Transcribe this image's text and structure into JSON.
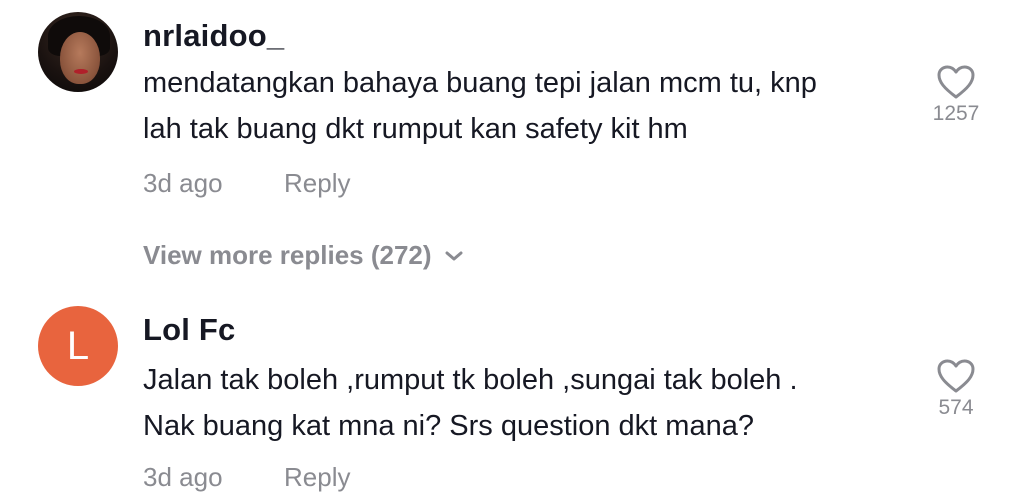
{
  "comments": [
    {
      "username": "nrlaidoo_",
      "avatar": "photo",
      "text_lines": [
        "mendatangkan bahaya buang tepi jalan mcm tu, knp",
        "lah tak buang dkt rumput kan safety kit hm"
      ],
      "time": "3d ago",
      "reply_label": "Reply",
      "likes": "1257",
      "view_more": "View more replies (272)"
    },
    {
      "username": "Lol Fc",
      "avatar_letter": "L",
      "avatar_color": "#e8643e",
      "text_lines": [
        "Jalan tak boleh ,rumput tk boleh ,sungai tak boleh .",
        "Nak buang kat mna ni? Srs question dkt mana?"
      ],
      "time": "3d ago",
      "reply_label": "Reply",
      "likes": "574"
    }
  ],
  "icons": {
    "like": "heart-outline-icon",
    "expand": "chevron-down-icon"
  },
  "colors": {
    "text_primary": "#161823",
    "text_secondary": "#8a8b91"
  }
}
